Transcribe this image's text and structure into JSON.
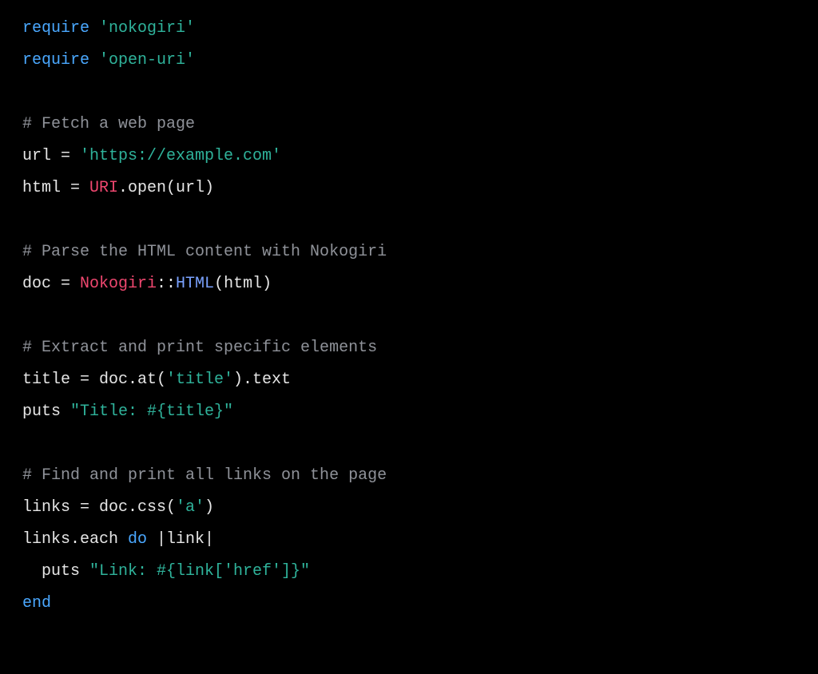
{
  "code": {
    "lines": [
      {
        "kind": "require",
        "kw": "require",
        "arg": "'nokogiri'"
      },
      {
        "kind": "require",
        "kw": "require",
        "arg": "'open-uri'"
      },
      {
        "kind": "blank"
      },
      {
        "kind": "comment",
        "text": "# Fetch a web page"
      },
      {
        "kind": "assign_str",
        "lhs": "url = ",
        "str": "'https://example.com'"
      },
      {
        "kind": "uri_open",
        "lhs": "html = ",
        "const": "URI",
        "rest": ".open(url)"
      },
      {
        "kind": "blank"
      },
      {
        "kind": "comment",
        "text": "# Parse the HTML content with Nokogiri"
      },
      {
        "kind": "nokogiri",
        "lhs": "doc = ",
        "const": "Nokogiri",
        "sep": "::",
        "htmlc": "HTML",
        "rest": "(html)"
      },
      {
        "kind": "blank"
      },
      {
        "kind": "comment",
        "text": "# Extract and print specific elements"
      },
      {
        "kind": "call_str",
        "pre": "title = doc.at(",
        "str": "'title'",
        "post": ").text"
      },
      {
        "kind": "puts",
        "pre": "puts ",
        "str": "\"Title: #{title}\""
      },
      {
        "kind": "blank"
      },
      {
        "kind": "comment",
        "text": "# Find and print all links on the page"
      },
      {
        "kind": "call_str",
        "pre": "links = doc.css(",
        "str": "'a'",
        "post": ")"
      },
      {
        "kind": "each_do",
        "pre": "links.each ",
        "kw": "do",
        "post": " |link|"
      },
      {
        "kind": "puts_indent",
        "indent": "  ",
        "pre": "puts ",
        "str": "\"Link: #{link['href']}\""
      },
      {
        "kind": "end",
        "kw": "end"
      }
    ]
  }
}
